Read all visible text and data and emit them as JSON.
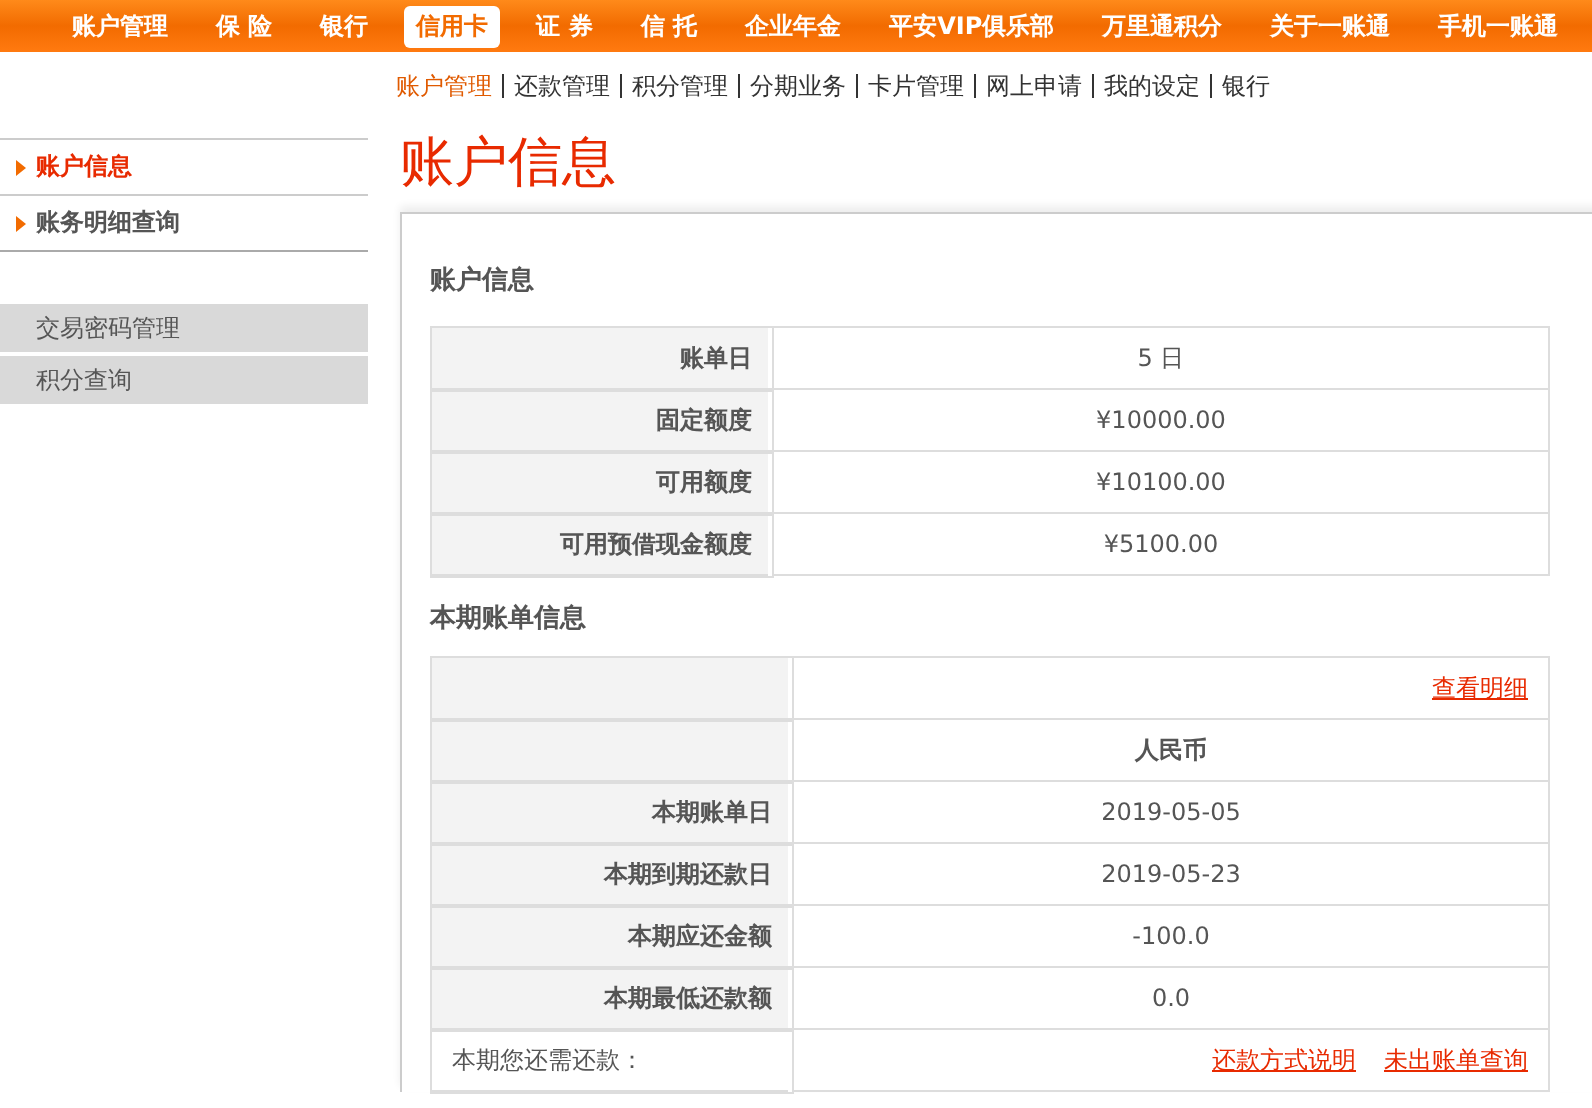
{
  "top_nav": [
    {
      "label": "账户管理",
      "selected": false
    },
    {
      "label": "保 险",
      "selected": false
    },
    {
      "label": "银行",
      "selected": false
    },
    {
      "label": "信用卡",
      "selected": true
    },
    {
      "label": "证 券",
      "selected": false
    },
    {
      "label": "信 托",
      "selected": false
    },
    {
      "label": "企业年金",
      "selected": false
    },
    {
      "label": "平安VIP俱乐部",
      "selected": false
    },
    {
      "label": "万里通积分",
      "selected": false
    },
    {
      "label": "关于一账通",
      "selected": false
    },
    {
      "label": "手机一账通",
      "selected": false
    }
  ],
  "sub_nav": [
    {
      "label": "账户管理",
      "selected": true
    },
    {
      "label": "还款管理",
      "selected": false
    },
    {
      "label": "积分管理",
      "selected": false
    },
    {
      "label": "分期业务",
      "selected": false
    },
    {
      "label": "卡片管理",
      "selected": false
    },
    {
      "label": "网上申请",
      "selected": false
    },
    {
      "label": "我的设定",
      "selected": false
    },
    {
      "label": "银行",
      "selected": false
    }
  ],
  "sidebar": {
    "items": [
      {
        "label": "账户信息",
        "selected": true
      },
      {
        "label": "账务明细查询",
        "selected": false
      }
    ],
    "tools": [
      {
        "label": "交易密码管理"
      },
      {
        "label": "积分查询"
      }
    ]
  },
  "page_title": "账户信息",
  "sections": [
    {
      "title": "账户信息",
      "rows": [
        {
          "kind": "plain",
          "label": "账单日",
          "value": "5 日"
        },
        {
          "kind": "plain",
          "label": "固定额度",
          "value": "¥10000.00"
        },
        {
          "kind": "plain",
          "label": "可用额度",
          "value": "¥10100.00"
        },
        {
          "kind": "plain",
          "label": "可用预借现金额度",
          "value": "¥5100.00"
        }
      ]
    },
    {
      "title": "本期账单信息",
      "rows": [
        {
          "kind": "links",
          "links": [
            "查看明细"
          ]
        },
        {
          "kind": "header",
          "value": "人民币"
        },
        {
          "kind": "plain",
          "label": "本期账单日",
          "value": "2019-05-05"
        },
        {
          "kind": "plain",
          "label": "本期到期还款日",
          "value": "2019-05-23"
        },
        {
          "kind": "plain",
          "label": "本期应还金额",
          "value": "-100.0"
        },
        {
          "kind": "plain",
          "label": "本期最低还款额",
          "value": "0.0"
        },
        {
          "kind": "footer",
          "label": "本期您还需还款：",
          "links": [
            "还款方式说明",
            "未出账单查询"
          ]
        }
      ]
    }
  ]
}
